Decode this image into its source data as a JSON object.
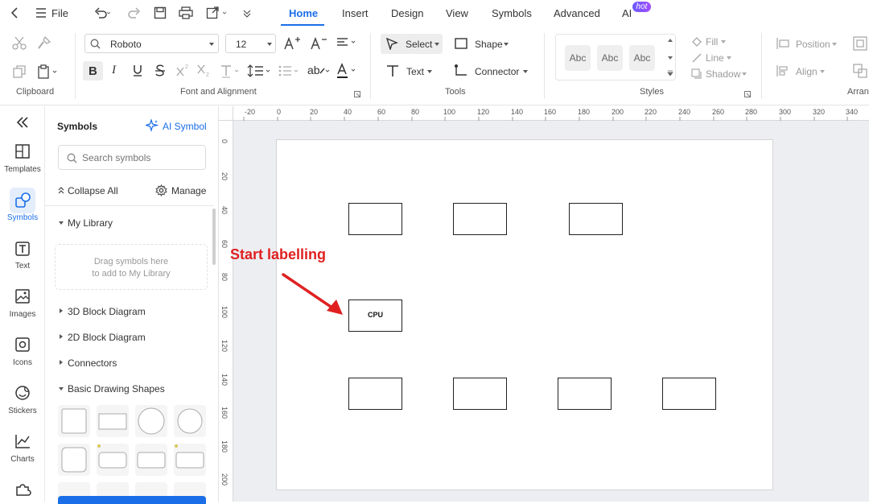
{
  "menu": {
    "file": "File",
    "tabs": [
      "Home",
      "Insert",
      "Design",
      "View",
      "Symbols",
      "Advanced",
      "AI"
    ],
    "hot_badge": "hot"
  },
  "toolbar": {
    "font_family": "Roboto",
    "font_size": "12",
    "select_label": "Select",
    "shape_label": "Shape",
    "text_label": "Text",
    "connector_label": "Connector",
    "style_samples": [
      "Abc",
      "Abc",
      "Abc"
    ],
    "fill_label": "Fill",
    "line_label": "Line",
    "shadow_label": "Shadow",
    "position_label": "Position",
    "align_label": "Align",
    "groups": [
      "Clipboard",
      "Font and Alignment",
      "Tools",
      "Styles",
      "Arran"
    ]
  },
  "rail": {
    "items": [
      "Templates",
      "Symbols",
      "Text",
      "Images",
      "Icons",
      "Stickers",
      "Charts"
    ]
  },
  "panel": {
    "title": "Symbols",
    "ai_symbol": "AI Symbol",
    "search_placeholder": "Search symbols",
    "collapse_all": "Collapse All",
    "manage": "Manage",
    "my_library": "My Library",
    "drop_hint_1": "Drag symbols here",
    "drop_hint_2": "to add to My Library",
    "categories": [
      "3D Block Diagram",
      "2D Block Diagram",
      "Connectors",
      "Basic Drawing Shapes"
    ]
  },
  "ruler": {
    "h_ticks": [
      "-20",
      "0",
      "20",
      "40",
      "60",
      "80",
      "100",
      "120",
      "140",
      "160",
      "180",
      "200",
      "220",
      "240",
      "260",
      "280",
      "300",
      "320",
      "340"
    ],
    "v_ticks": [
      "0",
      "20",
      "40",
      "60",
      "80",
      "100",
      "120",
      "140",
      "160",
      "180",
      "200"
    ]
  },
  "canvas": {
    "cpu_label": "CPU",
    "annotation": "Start labelling"
  },
  "colors": {
    "accent": "#1a6ee8",
    "annotation": "#e02020"
  }
}
